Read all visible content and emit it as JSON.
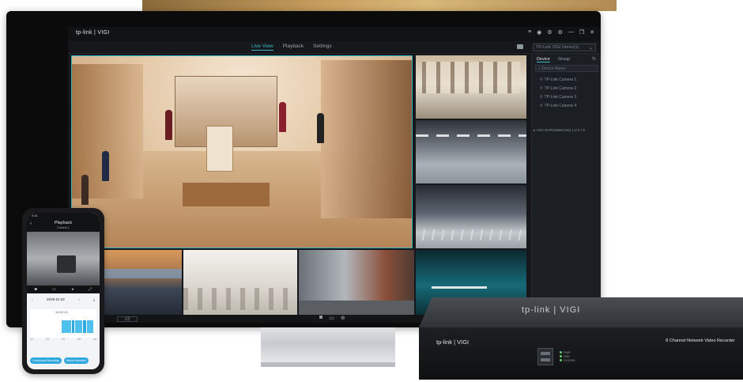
{
  "app": {
    "logo": "tp-link | VIGI",
    "window_icons": [
      "≡",
      "◉",
      "⚙",
      "⚙",
      "—",
      "❐",
      "✕"
    ]
  },
  "nav": {
    "tabs": [
      "Live View",
      "Playback",
      "Settings"
    ],
    "active_tab": "Live View",
    "device_select": "TP-Link VIGI Demo(1)"
  },
  "panel": {
    "tabs": [
      "Device",
      "Group"
    ],
    "search_placeholder": "Device Name",
    "cameras": [
      "TP-Link Camera 1",
      "TP-Link Camera 2",
      "TP-Link Camera 3",
      "TP-Link Camera 4"
    ],
    "nvr_row": "VIGI NVR1008H(UN) 1.0   0 / 8"
  },
  "bottom": {
    "page_label": "1/2"
  },
  "phone": {
    "status_time": "9:41",
    "title": "Playback",
    "subtitle": "Camera 1",
    "date": "2019-11-23",
    "time": "14:02:10",
    "ticks": [
      "12",
      "13",
      "14",
      "15",
      "16"
    ],
    "buttons": [
      "Continuous Recording",
      "Motion Detection"
    ]
  },
  "nvr": {
    "top_logo": "tp-link | VIGI",
    "front_logo": "tp-link | VIGI",
    "label": "8 Channel Network Video Recorder",
    "leds": [
      "PWR",
      "HDD",
      "SYSTEM"
    ]
  }
}
